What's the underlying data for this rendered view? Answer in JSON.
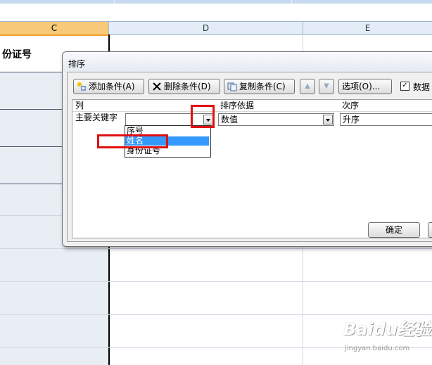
{
  "sheet": {
    "columns": [
      "C",
      "D",
      "E"
    ],
    "cell_c_header": "份证号"
  },
  "dialog": {
    "title": "排序",
    "toolbar": {
      "add_condition": "添加条件(A)",
      "delete_condition": "删除条件(D)",
      "copy_condition": "复制条件(C)",
      "options": "选项(O)...",
      "has_header_label": "数据",
      "has_header_checked": true
    },
    "grid": {
      "col_header": "列",
      "sort_on_header": "排序依据",
      "order_header": "次序",
      "row_label": "主要关键字",
      "column_value": "",
      "sort_on_value": "数值",
      "order_value": "升序"
    },
    "dropdown_options": [
      "序号",
      "姓名",
      "身份证号"
    ],
    "highlighted_option": "姓名",
    "ok_label": "确定"
  },
  "watermark": {
    "text": "Baidu经验",
    "sub": "jingyan.baidu.com"
  }
}
